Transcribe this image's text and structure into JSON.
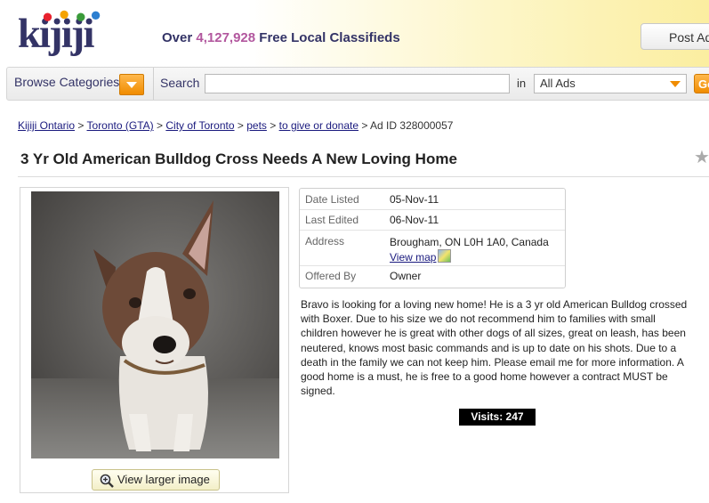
{
  "header": {
    "logo_text": "kijiji",
    "tagline_prefix": "Over",
    "tagline_count": "4,127,928",
    "tagline_suffix": "Free Local Classifieds",
    "post_ad_label": "Post Ad"
  },
  "searchbar": {
    "browse_label": "Browse Categories",
    "search_label": "Search",
    "search_value": "",
    "in_label": "in",
    "category_selected": "All Ads",
    "go_label": "Go"
  },
  "breadcrumb": {
    "items": [
      "Kijiji Ontario",
      "Toronto (GTA)",
      "City of Toronto",
      "pets",
      "to give or donate"
    ],
    "separator": ">",
    "current": "Ad ID 328000057"
  },
  "ad": {
    "title": "3 Yr Old American Bulldog Cross Needs A New Loving Home",
    "view_larger_label": "View larger image",
    "details": [
      {
        "key": "Date Listed",
        "value": "05-Nov-11"
      },
      {
        "key": "Last Edited",
        "value": "06-Nov-11"
      },
      {
        "key": "Address",
        "value": "Brougham, ON L0H 1A0, Canada",
        "link": "View map"
      },
      {
        "key": "Offered By",
        "value": "Owner"
      }
    ],
    "description": "Bravo is looking for a loving new home! He is a 3 yr old American Bulldog crossed with Boxer. Due to his size we do not recommend him to families with small children however he is great with other dogs of all sizes, great on leash, has been neutered, knows most basic commands and is up to date on his shots. Due to a death in the family we can not keep him. Please email me for more information. A good home is a must, he is free to a good home however a contract MUST be signed.",
    "visits": "Visits: 247"
  },
  "colors": {
    "brand_navy": "#333366",
    "brand_purple": "#b2579e",
    "accent_orange": "#f08c00",
    "link": "#1a1a7e"
  },
  "icons": [
    "dropdown-arrow-icon",
    "magnifier-icon",
    "map-icon",
    "star-icon"
  ]
}
